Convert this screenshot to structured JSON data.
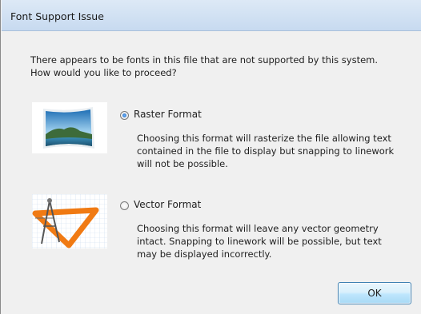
{
  "dialog": {
    "title": "Font Support Issue",
    "message": "There appears to be fonts in this file that are not supported by this system.\nHow would you like to proceed?"
  },
  "options": [
    {
      "label": "Raster Format",
      "selected": true,
      "icon": "raster-image-icon",
      "description": "Choosing this format will rasterize the file allowing text\ncontained in the file to display but snapping to linework\nwill not be possible."
    },
    {
      "label": "Vector Format",
      "selected": false,
      "icon": "vector-drafting-icon",
      "description": "Choosing this format will leave any vector geometry\nintact. Snapping to linework will be possible, but text\nmay be displayed incorrectly."
    }
  ],
  "buttons": {
    "ok": "OK"
  }
}
